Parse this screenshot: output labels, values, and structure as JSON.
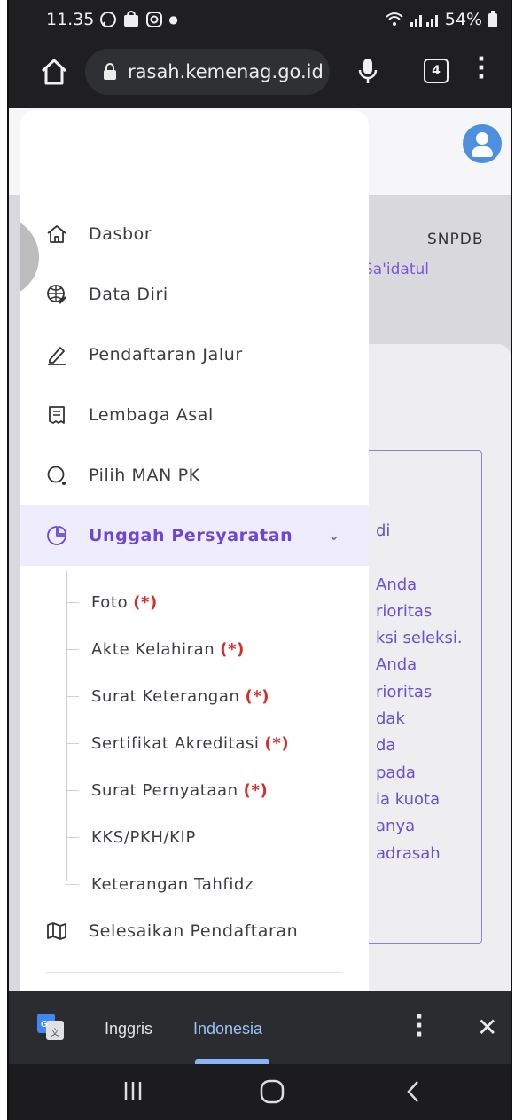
{
  "status_bar": {
    "time": "11.35",
    "battery": "54%"
  },
  "browser": {
    "url": "rasah.kemenag.go.id",
    "tab_count": "4"
  },
  "background_page": {
    "header_right": "SNPDB",
    "user_name_partial": "Sa'idatul",
    "body_fragment_lines": [
      "di",
      "",
      "Anda",
      "rioritas",
      "ksi seleksi.",
      "Anda",
      "rioritas",
      "dak",
      "da",
      "pada",
      "ia kuota",
      "anya",
      "adrasah"
    ]
  },
  "menu": {
    "items": [
      {
        "label": "Dasbor",
        "icon": "home-icon"
      },
      {
        "label": "Data Diri",
        "icon": "globe-edit-icon"
      },
      {
        "label": "Pendaftaran Jalur",
        "icon": "pencil-icon"
      },
      {
        "label": "Lembaga Asal",
        "icon": "receipt-icon"
      },
      {
        "label": "Pilih MAN PK",
        "icon": "search-circle-icon"
      },
      {
        "label": "Unggah Persyaratan",
        "icon": "upload-cube-icon",
        "active": true
      },
      {
        "label": "Selesaikan Pendaftaran",
        "icon": "map-icon"
      }
    ],
    "submenu": [
      {
        "label": "Foto",
        "required": "(*)"
      },
      {
        "label": "Akte Kelahiran",
        "required": "(*)"
      },
      {
        "label": "Surat Keterangan",
        "required": "(*)"
      },
      {
        "label": "Sertifikat Akreditasi",
        "required": "(*)"
      },
      {
        "label": "Surat Pernyataan",
        "required": "(*)"
      },
      {
        "label": "KKS/PKH/KIP",
        "required": ""
      },
      {
        "label": "Keterangan Tahfidz",
        "required": ""
      }
    ]
  },
  "translate_bar": {
    "from_language": "Inggris",
    "to_language": "Indonesia"
  },
  "colors": {
    "accent": "#6b46d9",
    "active_bg": "#efecfd",
    "required": "#d92b2b"
  }
}
